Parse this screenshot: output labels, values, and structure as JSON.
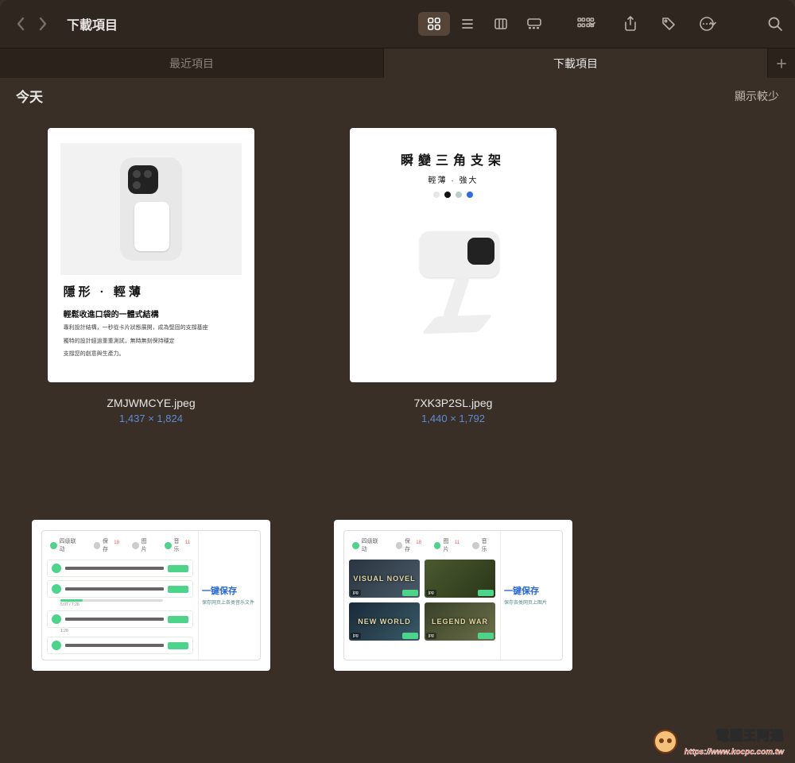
{
  "toolbar": {
    "title": "下載項目"
  },
  "tabs": {
    "recent": "最近項目",
    "downloads": "下載項目"
  },
  "section": {
    "heading": "今天",
    "show_less": "顯示較少"
  },
  "items": [
    {
      "filename": "ZMJWMCYE.jpeg",
      "dimensions": "1,437 × 1,824",
      "content": {
        "headline": "隱形 · 輕薄",
        "subhead": "輕鬆收進口袋的一體式結構",
        "body1": "專利設計結構，一秒從卡片狀態展開，成為堅固的支撐基座",
        "body2": "獨特的設計經過重重測試，無時無刻保持穩定",
        "body3": "支撐您的創意與生產力。"
      }
    },
    {
      "filename": "7XK3P2SL.jpeg",
      "dimensions": "1,440 × 1,792",
      "content": {
        "headline": "瞬變三角支架",
        "subhead": "輕薄 · 強大",
        "swatches": [
          "#e6e6e6",
          "#111111",
          "#b6d0c8",
          "#2e6be6"
        ]
      }
    },
    {
      "content": {
        "cta_title": "一键保存",
        "cta_sub": "保存网页上各类音乐文件",
        "tabs": [
          "四级联动",
          "保存",
          "图片",
          "音乐"
        ],
        "row_time": "5:07 / 7:26"
      }
    },
    {
      "content": {
        "cta_title": "一键保存",
        "cta_sub": "保存各类网页上图片",
        "tabs": [
          "四级联动",
          "保存",
          "图片",
          "音乐"
        ],
        "tiles": [
          "VISUAL NOVEL",
          "",
          "NEW WORLD",
          "LEGEND WAR"
        ]
      }
    }
  ],
  "watermark": {
    "name": "電腦王阿達",
    "url": "https://www.kocpc.com.tw"
  }
}
